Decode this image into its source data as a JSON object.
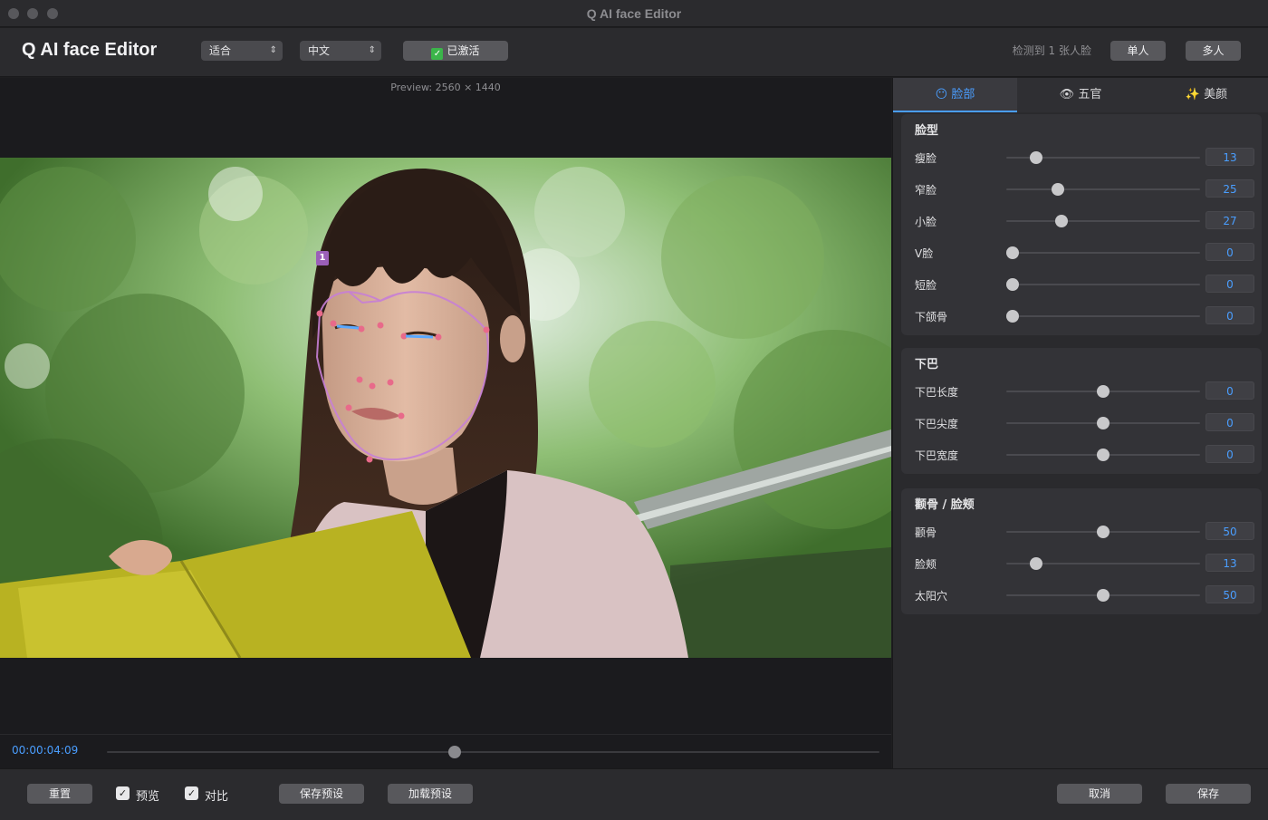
{
  "window": {
    "title": "Q AI face Editor"
  },
  "toolbar": {
    "app_title": "Q AI face Editor",
    "fit_select": "适合",
    "language_select": "中文",
    "activated_label": "已激活",
    "detected_text": "检测到 1 张人脸",
    "single_label": "单人",
    "multi_label": "多人"
  },
  "preview": {
    "label": "Preview: 2560 × 1440",
    "face_badge": "1",
    "timecode": "00:00:04:09",
    "playhead_fraction": 0.45
  },
  "tabs": [
    {
      "label": "脸部",
      "icon": "😶"
    },
    {
      "label": "五官",
      "icon": "👁"
    },
    {
      "label": "美颜",
      "icon": "✨"
    }
  ],
  "groups": [
    {
      "title": "脸型",
      "rows": [
        {
          "label": "瘦脸",
          "value": "13",
          "fraction": 0.13
        },
        {
          "label": "窄脸",
          "value": "25",
          "fraction": 0.25
        },
        {
          "label": "小脸",
          "value": "27",
          "fraction": 0.27
        },
        {
          "label": "V脸",
          "value": "0",
          "fraction": 0.0
        },
        {
          "label": "短脸",
          "value": "0",
          "fraction": 0.0
        },
        {
          "label": "下颌骨",
          "value": "0",
          "fraction": 0.0
        }
      ]
    },
    {
      "title": "下巴",
      "rows": [
        {
          "label": "下巴长度",
          "value": "0",
          "fraction": 0.5
        },
        {
          "label": "下巴尖度",
          "value": "0",
          "fraction": 0.5
        },
        {
          "label": "下巴宽度",
          "value": "0",
          "fraction": 0.5
        }
      ]
    },
    {
      "title": "颧骨 / 脸颊",
      "rows": [
        {
          "label": "颧骨",
          "value": "50",
          "fraction": 0.5
        },
        {
          "label": "脸颊",
          "value": "13",
          "fraction": 0.13
        },
        {
          "label": "太阳穴",
          "value": "50",
          "fraction": 0.5
        }
      ]
    }
  ],
  "bottom": {
    "reset_label": "重置",
    "preview_label": "预览",
    "compare_label": "对比",
    "save_preset_label": "保存预设",
    "load_preset_label": "加载预设",
    "cancel_label": "取消",
    "save_label": "保存",
    "preview_checked": true,
    "compare_checked": true
  },
  "colors": {
    "accent": "#4a9eff",
    "landmark": "#c77fd6",
    "activated": "#3bb54a"
  }
}
